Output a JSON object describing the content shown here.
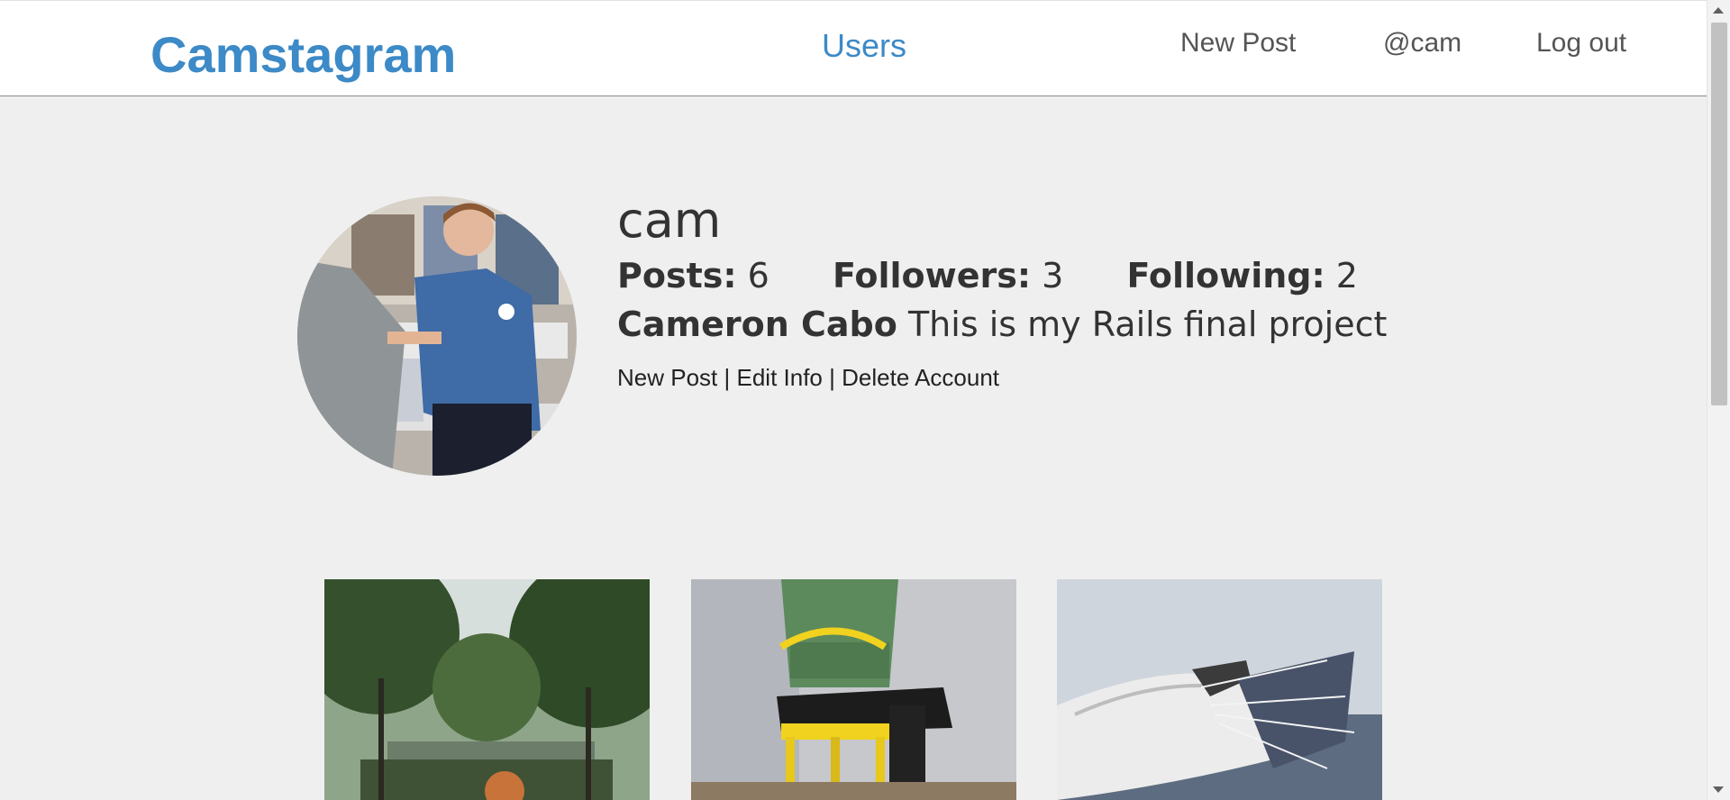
{
  "nav": {
    "brand": "Camstagram",
    "users": "Users",
    "new_post": "New Post",
    "handle": "@cam",
    "logout": "Log out"
  },
  "profile": {
    "username": "cam",
    "stats": [
      {
        "label": "Posts:",
        "value": "6"
      },
      {
        "label": "Followers:",
        "value": "3"
      },
      {
        "label": "Following:",
        "value": "2"
      }
    ],
    "full_name": "Cameron Cabo",
    "bio": "This is my Rails final project",
    "actions": {
      "new_post": "New Post",
      "sep1": "|",
      "edit_info": "Edit Info",
      "sep2": "|",
      "delete_account": "Delete Account"
    }
  },
  "colors": {
    "accent": "#3c8ac7",
    "background": "#efefef",
    "text": "#333333"
  }
}
